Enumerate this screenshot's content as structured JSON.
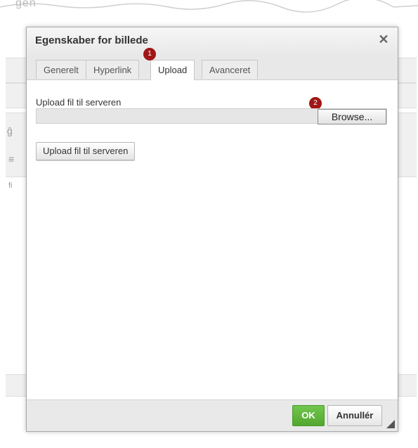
{
  "background": {
    "heading_fragment": "gen",
    "side_glyphs": [
      "ĝ",
      "≡",
      "fi"
    ]
  },
  "dialog": {
    "title": "Egenskaber for billede",
    "close_icon": "close-icon",
    "tabs": [
      {
        "label": "Generelt",
        "active": false
      },
      {
        "label": "Hyperlink",
        "active": false
      },
      {
        "label": "Upload",
        "active": true
      },
      {
        "label": "Avanceret",
        "active": false
      }
    ],
    "badges": [
      "1",
      "2"
    ],
    "upload": {
      "field_label": "Upload fil til serveren",
      "browse_label": "Browse...",
      "submit_label": "Upload fil til serveren"
    },
    "footer": {
      "ok_label": "OK",
      "cancel_label": "Annullér"
    }
  },
  "colors": {
    "ok_green": "#5cb336",
    "badge_red": "#a01616"
  }
}
